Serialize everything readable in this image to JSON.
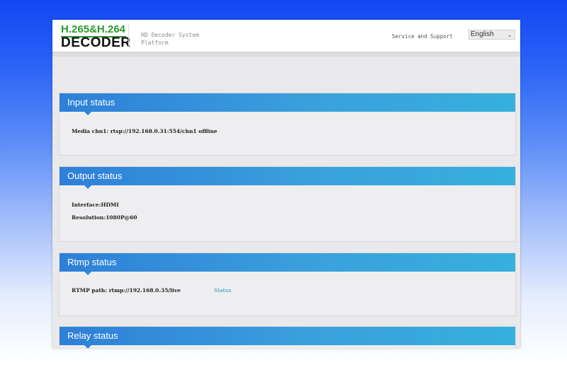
{
  "header": {
    "logo_line1": "H.265&H.264",
    "logo_line2": "DECODER",
    "subtitle": "HD Decoder System Platform",
    "support_link": "Service and Support",
    "language": "English",
    "colors": {
      "logo_green": "#2c9a2c",
      "panel_blue": "#2e7fd8",
      "panel_cyan": "#36b0dc",
      "link": "#2b8fb0"
    }
  },
  "input_status": {
    "title": "Input status",
    "media_label": "Media chn1:",
    "media_value": "rtsp://192.168.0.31:554/chn1 offline"
  },
  "output_status": {
    "title": "Output status",
    "interface_label": "Interface:",
    "interface_value": "HDMI",
    "resolution_label": "Resolution:",
    "resolution_value": "1080P@60"
  },
  "rtmp_status": {
    "title": "Rtmp status",
    "path_label": "RTMP path:",
    "path_value": "rtmp://192.168.0.35/live",
    "status_link": "Status"
  },
  "relay_status": {
    "title": "Relay status"
  }
}
